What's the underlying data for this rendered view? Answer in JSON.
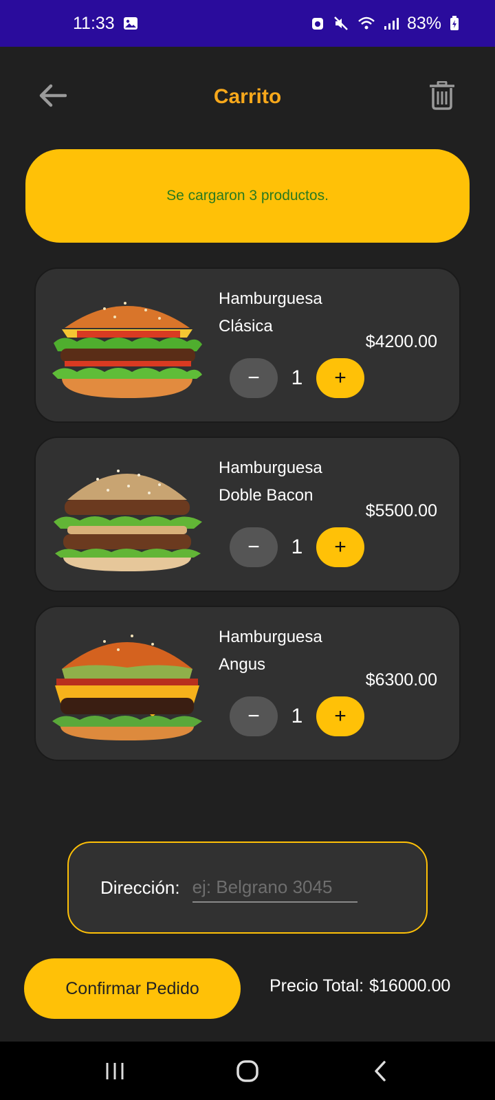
{
  "status_bar": {
    "time": "11:33",
    "battery": "83%",
    "icons": [
      "gallery-icon",
      "alarm-icon",
      "mute-icon",
      "wifi-icon",
      "signal-icon",
      "battery-icon"
    ]
  },
  "header": {
    "title": "Carrito",
    "back_icon": "arrow-left-icon",
    "trash_icon": "trash-icon"
  },
  "banner": {
    "message": "Se cargaron 3 productos."
  },
  "products": [
    {
      "name": "Hamburguesa Clásica",
      "price": "$4200.00",
      "quantity": "1",
      "minus": "−",
      "plus": "+",
      "image": "classic-burger"
    },
    {
      "name": "Hamburguesa Doble Bacon",
      "price": "$5500.00",
      "quantity": "1",
      "minus": "−",
      "plus": "+",
      "image": "double-bacon-burger"
    },
    {
      "name": "Hamburguesa Angus",
      "price": "$6300.00",
      "quantity": "1",
      "minus": "−",
      "plus": "+",
      "image": "angus-burger"
    }
  ],
  "address": {
    "label": "Dirección:",
    "value": "",
    "placeholder": "ej: Belgrano 3045"
  },
  "footer": {
    "confirm_label": "Confirmar Pedido",
    "total_label": "Precio Total:",
    "total_value": "$16000.00"
  },
  "nav_bar": {
    "icons": [
      "recent-apps-icon",
      "home-icon",
      "back-icon"
    ]
  },
  "colors": {
    "accent": "#ffc107",
    "title": "#f7a81b",
    "status_bar": "#2a0c9c",
    "background": "#202020",
    "card": "#313131"
  }
}
